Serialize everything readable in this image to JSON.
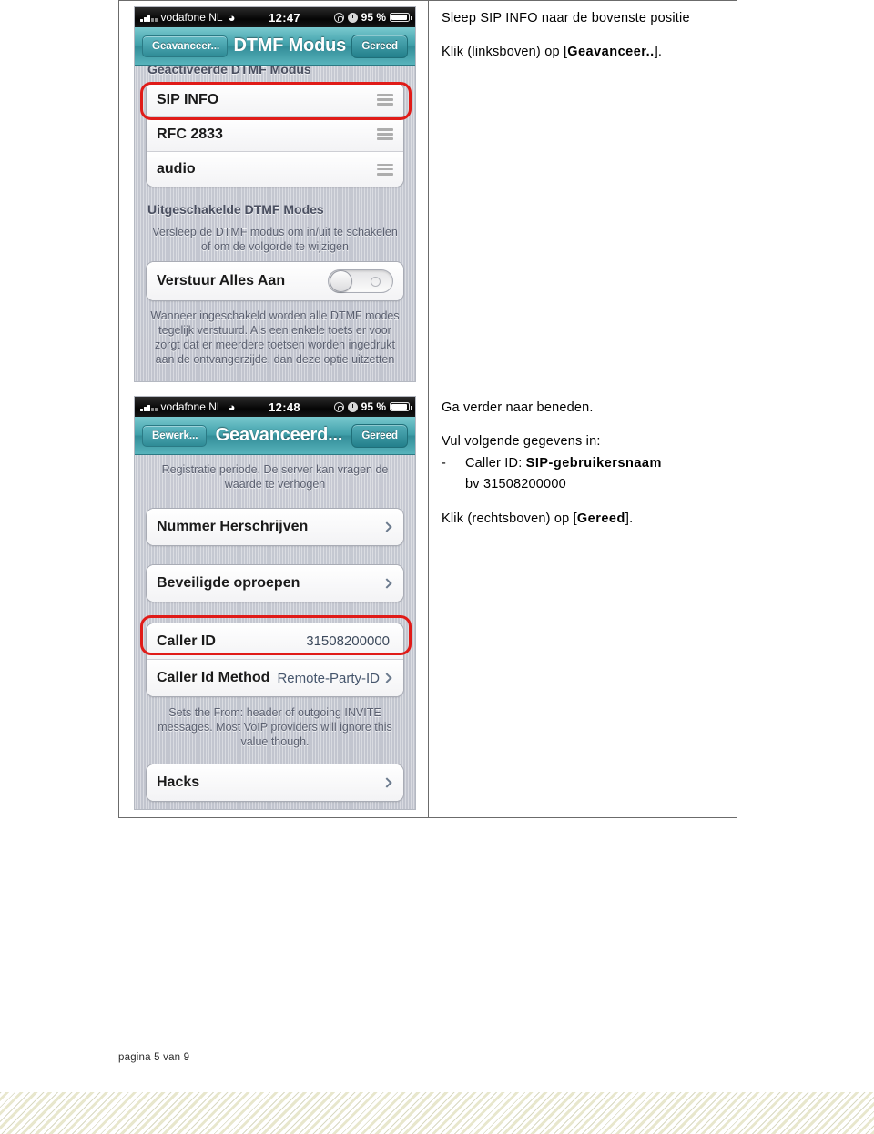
{
  "document": {
    "page_footer": "pagina 5 van 9"
  },
  "rows": [
    {
      "screenshot": {
        "statusbar": {
          "carrier": "vodafone NL",
          "wifi_icon": "wifi-icon",
          "time": "12:47",
          "rotation_lock_icon": "rotation-lock-icon",
          "alarm_icon": "alarm-clock-icon",
          "battery_percent": "95 %",
          "battery_icon": "battery-icon"
        },
        "navbar": {
          "back_label": "Geavanceer...",
          "title": "DTMF Modus",
          "done_label": "Gereed"
        },
        "clipped_header": "Geactiveerde DTMF Modus",
        "enabled_modes": [
          {
            "label": "SIP INFO",
            "accessory": "reorder-grip-icon"
          },
          {
            "label": "RFC 2833",
            "accessory": "reorder-grip-icon"
          },
          {
            "label": "audio",
            "accessory": "reorder-grip-icon"
          }
        ],
        "disabled_header": "Uitgeschakelde DTMF Modes",
        "disabled_note": "Versleep de DTMF modus om in/uit te schakelen of om de volgorde te wijzigen",
        "toggle_row": {
          "label": "Verstuur Alles Aan",
          "state": "off"
        },
        "toggle_note": "Wanneer ingeschakeld worden alle DTMF modes tegelijk verstuurd. Als een enkele toets er voor zorgt dat er meerdere toetsen worden ingedrukt aan de ontvangerzijde, dan deze optie uitzetten",
        "highlight": "sip-info-row"
      },
      "instructions": {
        "line1": "Sleep SIP INFO naar de bovenste positie",
        "line2_prefix": "Klik (linksboven) op [",
        "line2_bold": "Geavanceer..",
        "line2_suffix": "]."
      }
    },
    {
      "screenshot": {
        "statusbar": {
          "carrier": "vodafone NL",
          "wifi_icon": "wifi-icon",
          "time": "12:48",
          "rotation_lock_icon": "rotation-lock-icon",
          "alarm_icon": "alarm-clock-icon",
          "battery_percent": "95 %",
          "battery_icon": "battery-icon"
        },
        "navbar": {
          "back_label": "Bewerk...",
          "title": "Geavanceerd...",
          "done_label": "Gereed"
        },
        "top_note": "Registratie periode. De server kan vragen de waarde te verhogen",
        "group_a": [
          {
            "label": "Nummer Herschrijven",
            "value": "",
            "accessory": "chevron-right-icon"
          }
        ],
        "group_b": [
          {
            "label": "Beveiligde oproepen",
            "value": "",
            "accessory": "chevron-right-icon"
          }
        ],
        "group_c": [
          {
            "label": "Caller ID",
            "value": "31508200000",
            "accessory": ""
          },
          {
            "label": "Caller Id Method",
            "value": "Remote-Party-ID",
            "accessory": "chevron-right-icon"
          }
        ],
        "caller_note": "Sets the From: header of outgoing INVITE messages. Most VoIP providers will ignore this value though.",
        "group_d": [
          {
            "label": "Hacks",
            "value": "",
            "accessory": "chevron-right-icon"
          }
        ],
        "highlight": "caller-id-row"
      },
      "instructions": {
        "line1": "Ga verder naar beneden.",
        "line2": "Vul volgende gegevens in:",
        "bullet_dash": "-",
        "bullet_label": "Caller ID: ",
        "bullet_bold": "SIP-gebruikersnaam",
        "bullet_sub": "bv 31508200000",
        "line3_prefix": "Klik (rechtsboven) op [",
        "line3_bold": "Gereed",
        "line3_suffix": "]."
      }
    }
  ],
  "colors": {
    "highlight_red": "#e01b18",
    "nav_teal": "#3f9fa9",
    "screen_gray": "#c6c9d2"
  }
}
